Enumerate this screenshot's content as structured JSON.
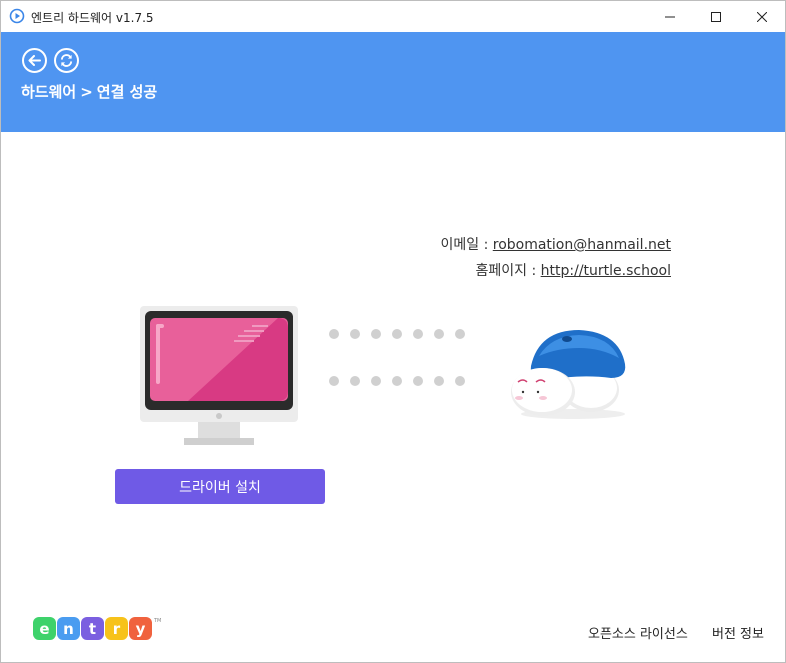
{
  "window": {
    "title": "엔트리 하드웨어 v1.7.5"
  },
  "header": {
    "breadcrumb_root": "하드웨어",
    "breadcrumb_separator": ">",
    "breadcrumb_current": "연결 성공"
  },
  "contact": {
    "email_label": "이메일 : ",
    "email_value": "robomation@hanmail.net",
    "homepage_label": "홈페이지 : ",
    "homepage_value": "http://turtle.school"
  },
  "main": {
    "driver_button_label": "드라이버 설치"
  },
  "footer": {
    "logo_letters": [
      "e",
      "n",
      "t",
      "r",
      "y"
    ],
    "logo_tm": "TM",
    "opensource_label": "오픈소스 라이선스",
    "version_label": "버전 정보"
  },
  "colors": {
    "header_bg": "#4f95f1",
    "button_bg": "#6f5ae6",
    "logo_tiles": [
      "#3ed26b",
      "#4a9cf0",
      "#7b5fe0",
      "#f7c21a",
      "#f0623e"
    ]
  },
  "icons": {
    "app": "entry-play-icon",
    "back": "arrow-left-icon",
    "refresh": "refresh-icon",
    "minimize": "minimize-icon",
    "maximize": "maximize-icon",
    "close": "close-icon"
  }
}
